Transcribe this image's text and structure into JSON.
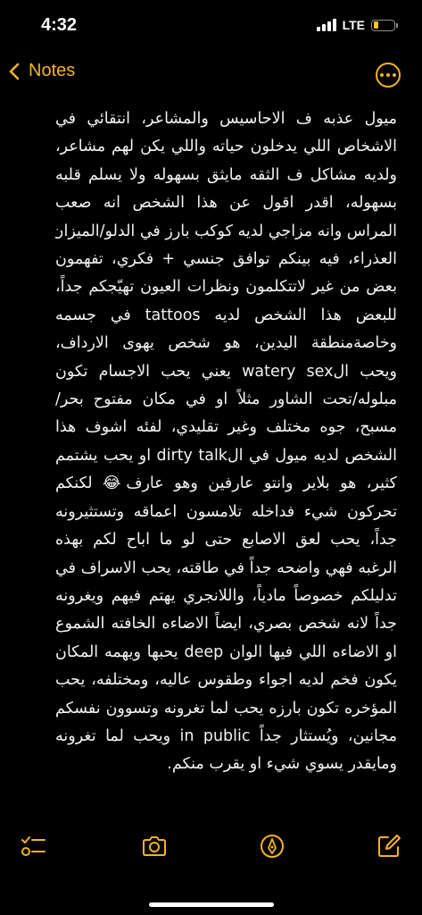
{
  "status_bar": {
    "time": "4:32",
    "network": "LTE",
    "battery_level": 0.25
  },
  "nav": {
    "back_label": "Notes",
    "back_icon": "chevron-left-icon",
    "more_icon": "ellipsis-circle-icon"
  },
  "colors": {
    "accent": "#f5b324",
    "background": "#000000",
    "text": "#f2f2f2"
  },
  "note": {
    "lines": [
      "ميول عذبه ف الاحاسيس والمشاعر، انتقائي في",
      "الاشخاص اللي يدخلون حياته واللي يكن لهم مشاعر،",
      "ولديه مشاكل ف الثقه مايثق بسهوله ولا يسلم قلبه",
      "بسهوله، اقدر اقول عن هذا الشخص انه صعب",
      "المراس وانه مزاجي لديه كوكب بارز في الدلو/الميزان/",
      "العذراء، فيه بينكم توافق جنسي + فكري، تفهمون",
      "بعض من غير لاتتكلمون ونظرات العيون تهيّجكم جداً،",
      "للبعض هذا الشخص لديه tattoos في جسمه",
      "وخاصةمنطقة اليدين، هو شخص يهوى الارداف،",
      "ويحب الwatery sex يعني يحب الاجسام تكون",
      "مبلوله/تحت الشاور مثلاً او في مكان مفتوح بحر/",
      "مسبح، جوه مختلف وغير تقليدي، لفئه اشوف هذا",
      "الشخص لديه ميول في الdirty talk او يحب يشتمم",
      "كثير، هو بلاير وانتو عارفين وهو عارف😂 لكنكم",
      "تحركون شيء فداخله تلامسون اعماقه وتستثيرونه",
      "جداً، يحب لعق الاصابع حتى لو ما اباح لكم بهذه",
      "الرغبه فهي واضحه جداً في طاقته، يحب الاسراف في",
      "تدليلكم خصوصاً مادياً، واللانجري يهتم فيهم ويغرونه",
      "جداً لانه شخص بصري، ايضاً الاضاءه الخافته الشموع",
      "او الاضاءه اللي فيها الوان deep يحبها ويهمه المكان",
      "يكون فخم لديه اجواء وطقوس عاليه، ومختلفه، يحب",
      "المؤخره تكون بارزه يحب لما تغرونه وتسوون نفسكم",
      "مجانين، ويُستثار جداً in public ويحب لما تغرونه",
      "ومايقدر يسوي شيء او يقرب منكم."
    ]
  },
  "toolbar": {
    "checklist_icon": "checklist-icon",
    "camera_icon": "camera-icon",
    "markup_icon": "markup-pen-icon",
    "compose_icon": "compose-icon"
  }
}
